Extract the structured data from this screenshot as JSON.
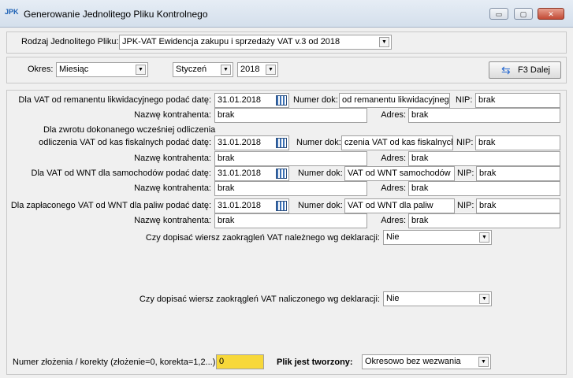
{
  "window": {
    "title": "Generowanie Jednolitego Pliku Kontrolnego",
    "icon": "JPK",
    "buttons": {
      "minimize": "▭",
      "maximize": "▢",
      "close": "✕"
    }
  },
  "rodzaj": {
    "label": "Rodzaj Jednolitego Pliku:",
    "value": "JPK-VAT Ewidencja zakupu i sprzedaży VAT v.3 od 2018"
  },
  "okres": {
    "label": "Okres:",
    "value": "Miesiąc",
    "month": "Styczeń",
    "year": "2018"
  },
  "next_button": {
    "label": "F3 Dalej",
    "icon": "⇆"
  },
  "sections": [
    {
      "date_label": "Dla VAT od remanentu likwidacyjnego podać datę:",
      "date": "31.01.2018",
      "num_label": "Numer dok:",
      "num_value": "od remanentu likwidacyjnego",
      "nip_label": "NIP:",
      "nip_value": "brak",
      "contractor_label": "Nazwę kontrahenta:",
      "contractor_value": "brak",
      "address_label": "Adres:",
      "address_value": "brak"
    },
    {
      "date_label_line1": "Dla zwrotu dokonanego wcześniej odliczenia",
      "date_label": "odliczenia VAT od kas fiskalnych podać datę:",
      "date": "31.01.2018",
      "num_label": "Numer dok:",
      "num_value": "czenia VAT od kas fiskalnych",
      "nip_label": "NIP:",
      "nip_value": "brak",
      "contractor_label": "Nazwę kontrahenta:",
      "contractor_value": "brak",
      "address_label": "Adres:",
      "address_value": "brak"
    },
    {
      "date_label": "Dla VAT od  WNT dla samochodów podać datę:",
      "date": "31.01.2018",
      "num_label": "Numer dok:",
      "num_value": "VAT od WNT samochodów",
      "nip_label": "NIP:",
      "nip_value": "brak",
      "contractor_label": "Nazwę kontrahenta:",
      "contractor_value": "brak",
      "address_label": "Adres:",
      "address_value": "brak"
    },
    {
      "date_label": "Dla zapłaconego VAT od WNT dla paliw podać datę:",
      "date": "31.01.2018",
      "num_label": "Numer dok:",
      "num_value": "VAT od WNT dla paliw",
      "nip_label": "NIP:",
      "nip_value": "brak",
      "contractor_label": "Nazwę kontrahenta:",
      "contractor_value": "brak",
      "address_label": "Adres:",
      "address_value": "brak"
    }
  ],
  "rounding_due": {
    "label": "Czy dopisać wiersz zaokrągleń VAT należnego wg deklaracji:",
    "value": "Nie"
  },
  "rounding_input": {
    "label": "Czy dopisać wiersz zaokrągleń VAT naliczonego wg deklaracji:",
    "value": "Nie"
  },
  "submission": {
    "label": "Numer złożenia / korekty (złożenie=0, korekta=1,2...)",
    "value": "0"
  },
  "created": {
    "label": "Plik jest tworzony:",
    "value": "Okresowo bez wezwania"
  },
  "arrow_glyph": "▼"
}
